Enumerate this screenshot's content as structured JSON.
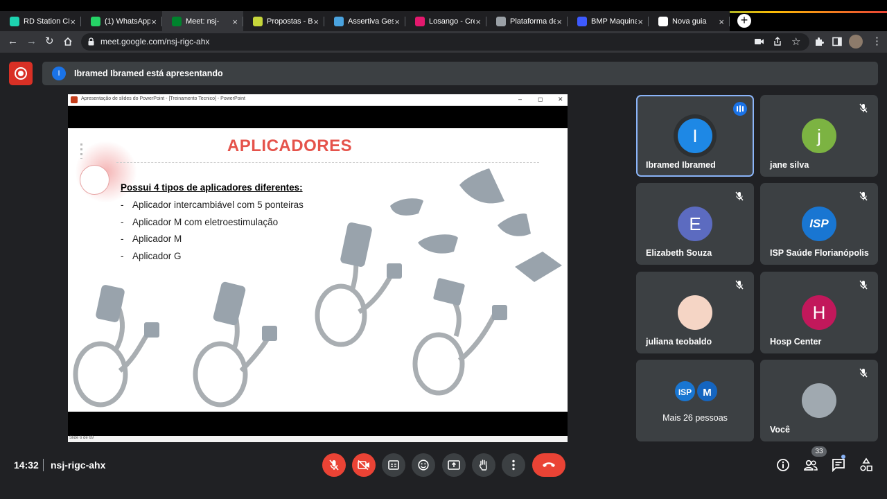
{
  "browser": {
    "tabs": [
      {
        "title": "RD Station CR",
        "icon": "rd-station-icon",
        "color": "#1dd3b0"
      },
      {
        "title": "(1) WhatsApp",
        "icon": "whatsapp-icon",
        "color": "#25d366"
      },
      {
        "title": "Meet: nsj-",
        "icon": "google-meet-icon",
        "color": "#00832d",
        "active": true
      },
      {
        "title": "Propostas - Bi",
        "icon": "bitrix-icon",
        "color": "#c6d63b"
      },
      {
        "title": "Assertiva Gest",
        "icon": "assertiva-icon",
        "color": "#4aa3df"
      },
      {
        "title": "Losango - Cre",
        "icon": "losango-icon",
        "color": "#e4196e"
      },
      {
        "title": "Plataforma de",
        "icon": "globe-icon",
        "color": "#9aa0a6"
      },
      {
        "title": "BMP Maquina",
        "icon": "bmp-icon",
        "color": "#3d5afe"
      },
      {
        "title": "Nova guia",
        "icon": "chrome-icon",
        "color": "#ffffff"
      }
    ],
    "url": "meet.google.com/nsj-rigc-ahx"
  },
  "banner": {
    "avatar_letter": "I",
    "text": "Ibramed Ibramed está apresentando"
  },
  "presentation": {
    "window_title": "Apresentação de slides do PowerPoint - [Treinamento Tecnico] - PowerPoint",
    "slide_title": "APLICADORES",
    "heading": "Possui 4 tipos de aplicadores diferentes:",
    "bullets": [
      "Aplicador intercambiável com 5 ponteiras",
      "Aplicador M com eletroestimulação",
      "Aplicador M",
      "Aplicador G"
    ],
    "bullet_dash": "-",
    "status": "Slide 6 de 69"
  },
  "participants": [
    {
      "name": "Ibramed Ibramed",
      "letter": "I",
      "color": "#1e88e5",
      "speaking": true
    },
    {
      "name": "jane silva",
      "letter": "j",
      "color": "#7cb342",
      "muted": true
    },
    {
      "name": "Elizabeth Souza",
      "letter": "E",
      "color": "#5c6bc0",
      "muted": true
    },
    {
      "name": "ISP Saúde Florianópolis",
      "letter": "ISP",
      "color": "#1976d2",
      "muted": true
    },
    {
      "name": "juliana teobaldo",
      "letter": "",
      "color": "#f5d5c5",
      "muted": true
    },
    {
      "name": "Hosp Center",
      "letter": "H",
      "color": "#c2185b",
      "muted": true
    },
    {
      "name": "Mais 26 pessoas",
      "letter": "M",
      "color": "#1565c0"
    },
    {
      "name": "Você",
      "letter": "",
      "color": "#a0a9b0",
      "muted": true
    }
  ],
  "more_avatar_letters": [
    "ISP",
    "M"
  ],
  "meeting": {
    "time": "14:32",
    "code": "nsj-rigc-ahx",
    "people_count": "33"
  }
}
